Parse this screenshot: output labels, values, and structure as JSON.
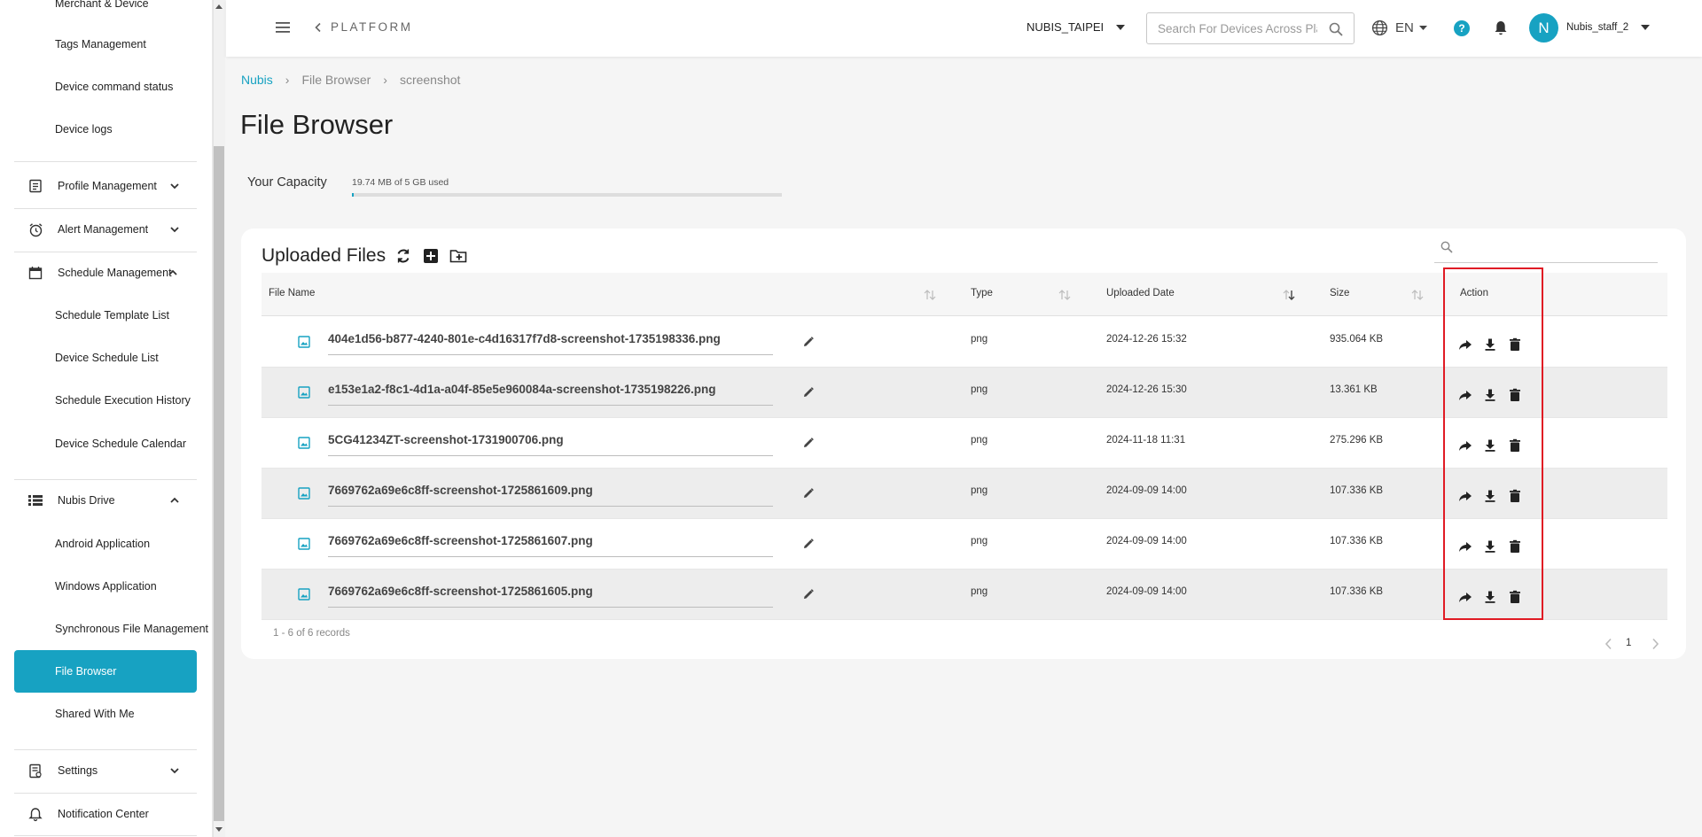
{
  "sidebar": {
    "items": [
      {
        "label": "Merchant & Device"
      },
      {
        "label": "Tags Management"
      },
      {
        "label": "Device command status"
      },
      {
        "label": "Device logs"
      },
      {
        "label": "Profile Management"
      },
      {
        "label": "Alert Management"
      },
      {
        "label": "Schedule Management"
      },
      {
        "label": "Schedule Template List"
      },
      {
        "label": "Device Schedule List"
      },
      {
        "label": "Schedule Execution History"
      },
      {
        "label": "Device Schedule Calendar"
      },
      {
        "label": "Nubis Drive"
      },
      {
        "label": "Android Application"
      },
      {
        "label": "Windows Application"
      },
      {
        "label": "Synchronous File Management"
      },
      {
        "label": "File Browser"
      },
      {
        "label": "Shared With Me"
      },
      {
        "label": "Settings"
      },
      {
        "label": "Notification Center"
      }
    ]
  },
  "header": {
    "platform": "PLATFORM",
    "tenant": "NUBIS_TAIPEI",
    "search_placeholder": "Search For Devices Across Platform",
    "language": "EN",
    "help": "?",
    "avatar_initial": "N",
    "username": "Nubis_staff_2"
  },
  "breadcrumb": {
    "root": "Nubis",
    "parent": "File Browser",
    "current": "screenshot"
  },
  "page_title": "File Browser",
  "capacity": {
    "label": "Your Capacity",
    "text": "19.74 MB of 5 GB used",
    "used_fraction": 0.004
  },
  "uploaded": {
    "title": "Uploaded Files",
    "search_placeholder": ""
  },
  "table": {
    "columns": {
      "name": "File Name",
      "type": "Type",
      "date": "Uploaded Date",
      "size": "Size",
      "action": "Action"
    },
    "rows": [
      {
        "name": "404e1d56-b877-4240-801e-c4d16317f7d8-screenshot-1735198336.png",
        "type": "png",
        "date": "2024-12-26 15:32",
        "size": "935.064 KB"
      },
      {
        "name": "e153e1a2-f8c1-4d1a-a04f-85e5e960084a-screenshot-1735198226.png",
        "type": "png",
        "date": "2024-12-26 15:30",
        "size": "13.361 KB"
      },
      {
        "name": "5CG41234ZT-screenshot-1731900706.png",
        "type": "png",
        "date": "2024-11-18 11:31",
        "size": "275.296 KB"
      },
      {
        "name": "7669762a69e6c8ff-screenshot-1725861609.png",
        "type": "png",
        "date": "2024-09-09 14:00",
        "size": "107.336 KB"
      },
      {
        "name": "7669762a69e6c8ff-screenshot-1725861607.png",
        "type": "png",
        "date": "2024-09-09 14:00",
        "size": "107.336 KB"
      },
      {
        "name": "7669762a69e6c8ff-screenshot-1725861605.png",
        "type": "png",
        "date": "2024-09-09 14:00",
        "size": "107.336 KB"
      }
    ],
    "records": "1 - 6 of 6 records",
    "page": "1"
  },
  "colors": {
    "accent": "#17a2c2",
    "highlight": "#e01b24"
  }
}
